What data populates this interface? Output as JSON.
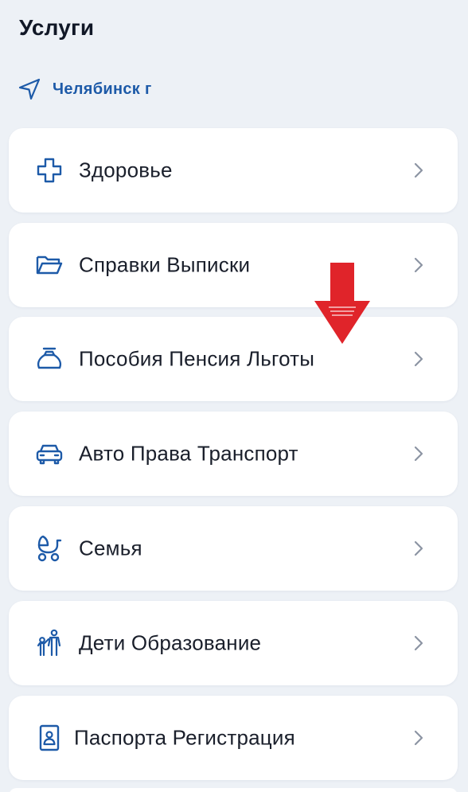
{
  "header": {
    "title": "Услуги"
  },
  "location": {
    "icon": "navigation-arrow-icon",
    "city": "Челябинск г"
  },
  "services": [
    {
      "icon": "medical-cross-icon",
      "label": "Здоровье"
    },
    {
      "icon": "folder-icon",
      "label": "Справки Выписки"
    },
    {
      "icon": "money-bag-icon",
      "label": "Пособия Пенсия Льготы"
    },
    {
      "icon": "car-icon",
      "label": "Авто Права Транспорт"
    },
    {
      "icon": "baby-stroller-icon",
      "label": "Семья"
    },
    {
      "icon": "parent-child-icon",
      "label": "Дети Образование"
    },
    {
      "icon": "passport-icon",
      "label": "Паспорта Регистрация"
    }
  ],
  "annotation": {
    "icon": "red-down-arrow-icon",
    "color": "#e0242a"
  },
  "colors": {
    "background": "#edf1f6",
    "card": "#ffffff",
    "accent": "#1d5aa8",
    "text": "#1a1f2b",
    "chevron": "#8c94a3"
  }
}
